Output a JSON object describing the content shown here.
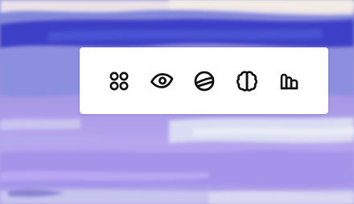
{
  "wallpaper": {
    "palette": [
      "#3d3fc4",
      "#5a5fd6",
      "#8f86dc",
      "#a59ae6",
      "#b8a8f0",
      "#c4d4ee",
      "#ece3e6"
    ]
  },
  "toolbar": {
    "background": "#ffffff",
    "icon_color": "#111111",
    "tools": [
      {
        "icon": "apps-icon"
      },
      {
        "icon": "eye-icon"
      },
      {
        "icon": "planet-icon"
      },
      {
        "icon": "brain-icon"
      },
      {
        "icon": "bar-chart-icon"
      }
    ]
  }
}
